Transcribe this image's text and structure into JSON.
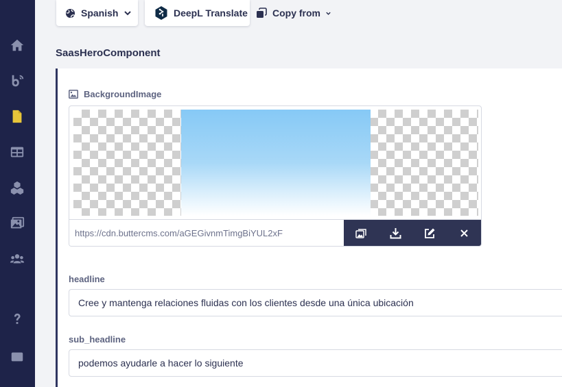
{
  "toolbar": {
    "language_label": "Spanish",
    "deepl_label": "DeepL Translate",
    "copy_from_label": "Copy from"
  },
  "sidebar": {
    "items": [
      {
        "icon": "home-icon"
      },
      {
        "icon": "blog-icon"
      },
      {
        "icon": "pages-icon",
        "active": true
      },
      {
        "icon": "collections-icon"
      },
      {
        "icon": "components-icon"
      },
      {
        "icon": "media-icon"
      },
      {
        "icon": "users-icon"
      },
      {
        "icon": "help-icon"
      },
      {
        "icon": "window-icon"
      }
    ]
  },
  "component": {
    "title": "SaasHeroComponent",
    "background_image": {
      "label": "BackgroundImage",
      "url": "https://cdn.buttercms.com/aGEGivnmTimgBiYUL2xF"
    },
    "headline": {
      "label": "headline",
      "value": "Cree y mantenga relaciones fluidas con los clientes desde una única ubicación"
    },
    "sub_headline": {
      "label": "sub_headline",
      "value": "podemos ayudarle a hacer lo siguiente"
    }
  },
  "colors": {
    "sidebar_bg": "#1e2349",
    "sidebar_icon": "#8a90ad",
    "sidebar_active": "#e8c53a",
    "action_bar_bg": "#2f3454"
  }
}
